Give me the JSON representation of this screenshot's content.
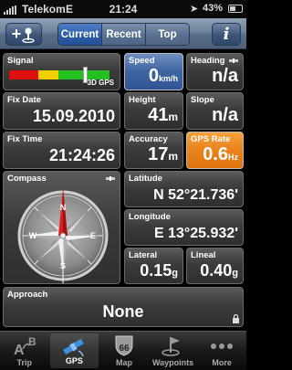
{
  "status_bar": {
    "carrier": "Telekom",
    "network": "E",
    "time": "21:24",
    "battery": "43%"
  },
  "nav": {
    "add_label": "+",
    "segments": [
      {
        "label": "Current",
        "active": true
      },
      {
        "label": "Recent",
        "active": false
      },
      {
        "label": "Top",
        "active": false
      }
    ],
    "info_label": "i"
  },
  "signal": {
    "label": "Signal",
    "mode": "3D GPS",
    "level": 0.75
  },
  "speed": {
    "label": "Speed",
    "value": "0",
    "unit": "km/h"
  },
  "heading": {
    "label": "Heading",
    "value": "n/a"
  },
  "fix_date": {
    "label": "Fix Date",
    "value": "15.09.2010"
  },
  "height": {
    "label": "Height",
    "value": "41",
    "unit": "m"
  },
  "slope": {
    "label": "Slope",
    "value": "n/a"
  },
  "fix_time": {
    "label": "Fix Time",
    "value": "21:24:26"
  },
  "accuracy": {
    "label": "Accuracy",
    "value": "17",
    "unit": "m"
  },
  "gps_rate": {
    "label": "GPS Rate",
    "value": "0.6",
    "unit": "Hz"
  },
  "compass": {
    "label": "Compass",
    "letters": {
      "n": "N",
      "e": "E",
      "s": "S",
      "w": "W"
    }
  },
  "latitude": {
    "label": "Latitude",
    "value": "N 52°21.736'"
  },
  "longitude": {
    "label": "Longitude",
    "value": "E 13°25.932'"
  },
  "lateral": {
    "label": "Lateral",
    "value": "0.15",
    "unit": "g"
  },
  "lineal": {
    "label": "Lineal",
    "value": "0.40",
    "unit": "g"
  },
  "approach": {
    "label": "Approach",
    "value": "None"
  },
  "tabs": [
    {
      "label": "Trip",
      "icon": "trip-ab-icon",
      "active": false
    },
    {
      "label": "GPS",
      "icon": "gps-satellite-icon",
      "active": true
    },
    {
      "label": "Map",
      "icon": "map-route66-icon",
      "active": false
    },
    {
      "label": "Waypoints",
      "icon": "waypoint-flag-icon",
      "active": false
    },
    {
      "label": "More",
      "icon": "more-dots-icon",
      "active": false
    }
  ],
  "colors": {
    "accent_blue": "#3e64a0",
    "accent_orange": "#e8821a",
    "needle_red": "#d92020"
  }
}
